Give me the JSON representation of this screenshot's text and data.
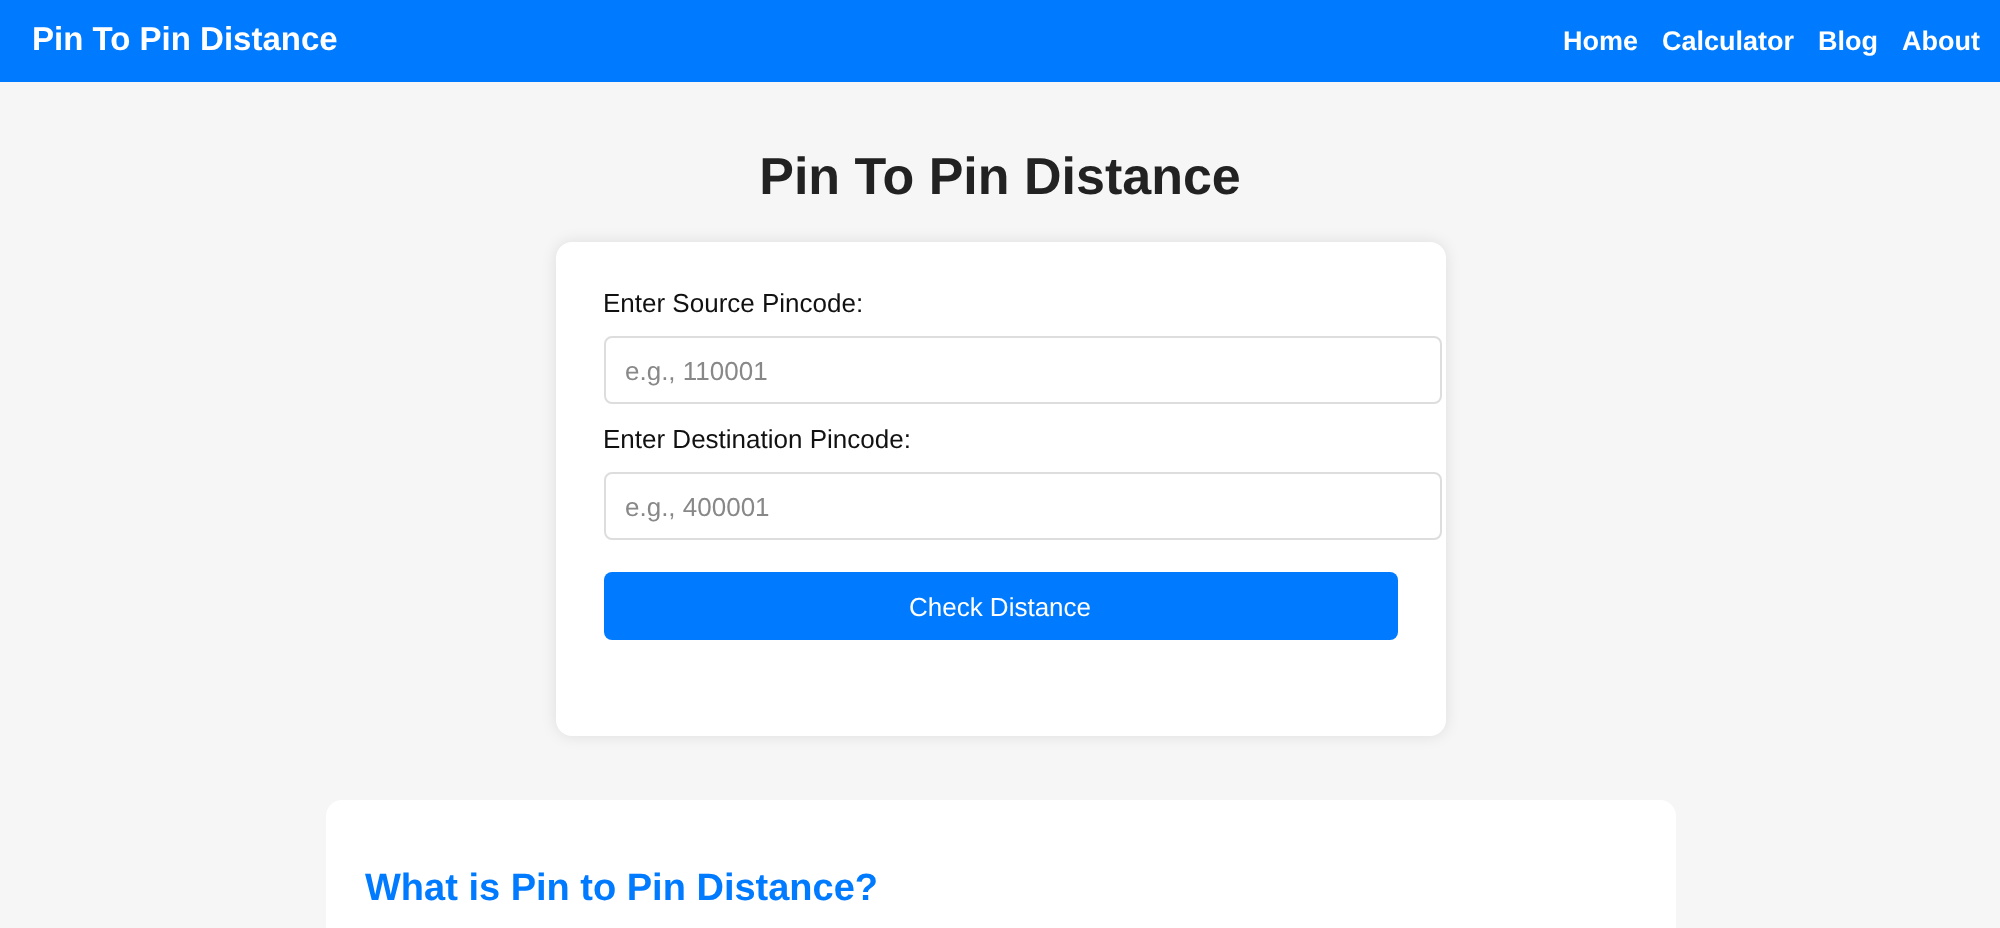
{
  "navbar": {
    "brand": "Pin To Pin Distance",
    "links": [
      {
        "label": "Home"
      },
      {
        "label": "Calculator"
      },
      {
        "label": "Blog"
      },
      {
        "label": "About"
      }
    ]
  },
  "page_title": "Pin To Pin Distance",
  "form": {
    "fields": [
      {
        "label": "Enter Source Pincode:",
        "placeholder": "e.g., 110001"
      },
      {
        "label": "Enter Destination Pincode:",
        "placeholder": "e.g., 400001"
      }
    ],
    "button": "Check Distance"
  },
  "info": {
    "heading": "What is Pin to Pin Distance?"
  }
}
